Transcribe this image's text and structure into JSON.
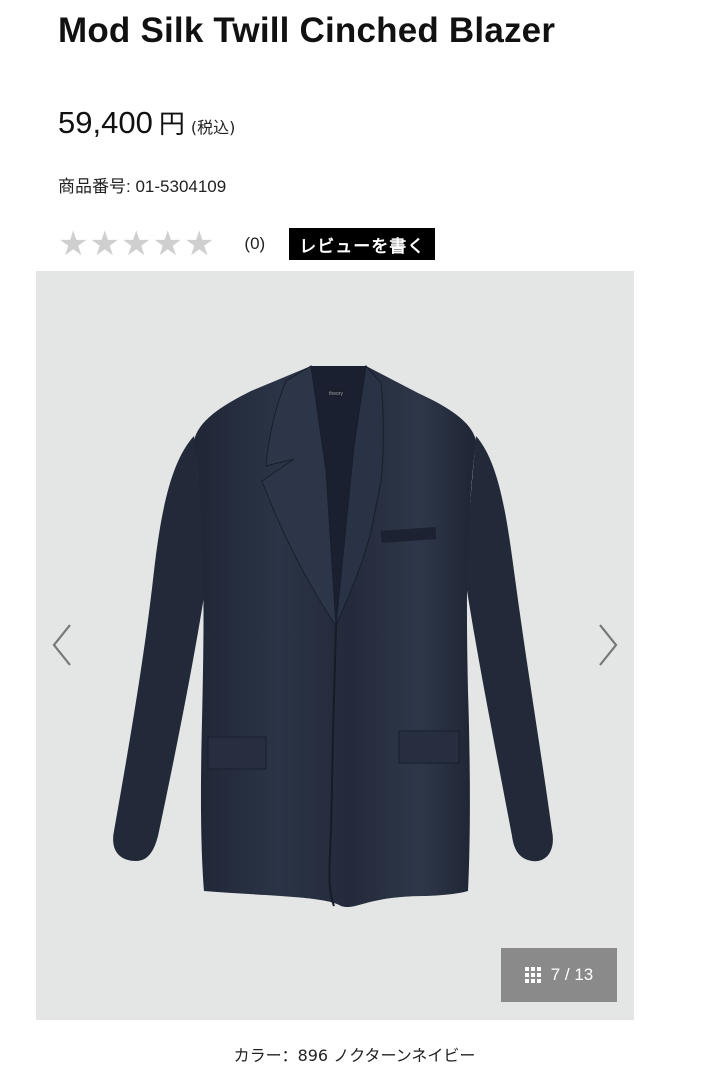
{
  "product": {
    "title": "Mod Silk Twill Cinched Blazer",
    "price": "59,400",
    "currency": "円",
    "tax_note": "(税込)",
    "sku_label": "商品番号",
    "sku_separator": ":",
    "sku_value": "01-5304109"
  },
  "rating": {
    "stars_filled": 0,
    "stars_total": 5,
    "count": "(0)",
    "review_button_label": "レビューを書く"
  },
  "gallery": {
    "current_index": "7",
    "separator": "/",
    "total": "13",
    "counter_text": "7 / 13",
    "garment_label": "theory",
    "icons": [
      "chevron-left-icon",
      "chevron-right-icon",
      "grid-icon"
    ],
    "background_color": "#e4e5e5",
    "garment_color": "#252d3e"
  },
  "color": {
    "label": "カラー：896 ノクターンネイビー"
  }
}
